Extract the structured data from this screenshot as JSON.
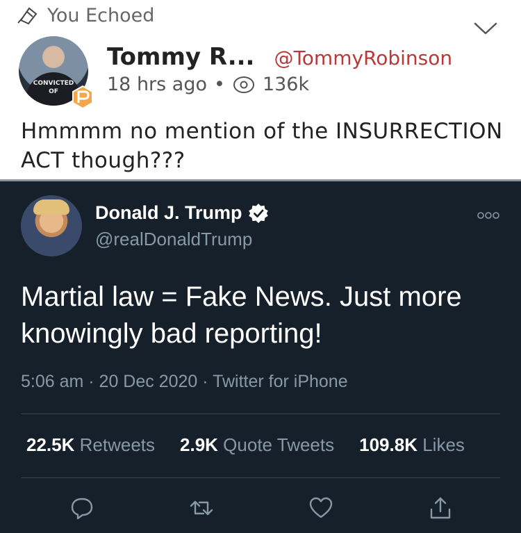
{
  "echo": {
    "label": "You Echoed"
  },
  "parler_post": {
    "author_name": "Tommy R...",
    "author_handle": "@TommyRobinson",
    "time_ago": "18 hrs ago",
    "separator": "•",
    "views": "136k",
    "avatar_shirt_text": "CONVICTED OF",
    "text": "Hmmmm no mention of the INSURRECTION ACT though???"
  },
  "tweet": {
    "author_name": "Donald J. Trump",
    "author_handle": "@realDonaldTrump",
    "text": "Martial law = Fake News. Just more knowingly bad reporting!",
    "meta": "5:06 am · 20 Dec 2020 · Twitter for iPhone",
    "retweets_count": "22.5K",
    "retweets_label": "Retweets",
    "quotes_count": "2.9K",
    "quotes_label": "Quote Tweets",
    "likes_count": "109.8K",
    "likes_label": "Likes"
  },
  "colors": {
    "tweet_bg": "#15202b",
    "handle_red": "#b73a3a",
    "secondary_text": "#8899a6",
    "badge_orange": "#f3a64a",
    "verified_white": "#ffffff"
  },
  "icons": [
    "echo-icon",
    "chevron-down-icon",
    "parler-badge-icon",
    "views-icon",
    "verified-icon",
    "more-icon",
    "reply-icon",
    "retweet-icon",
    "like-icon",
    "share-icon"
  ]
}
